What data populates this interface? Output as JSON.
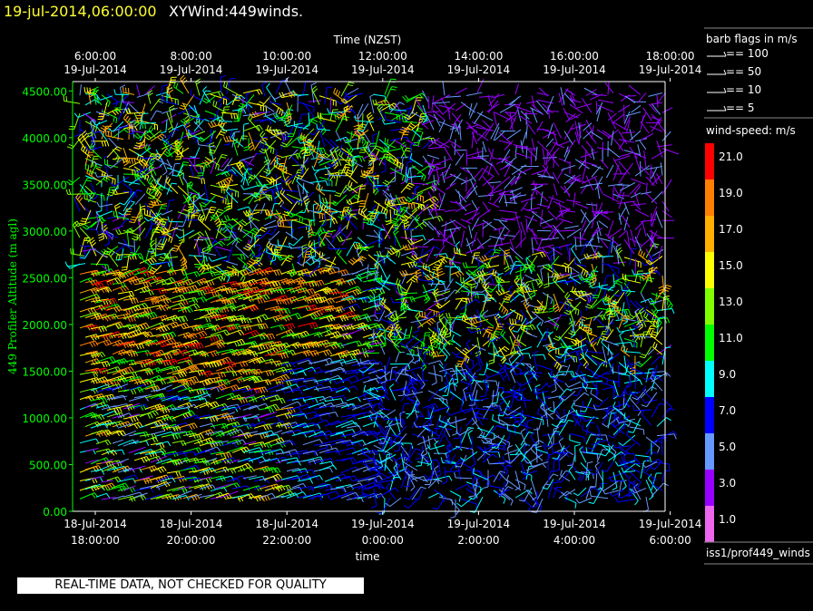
{
  "header": {
    "date_label": "19-jul-2014,06:00:00",
    "product_label": "XYWind:449winds."
  },
  "notice": "REAL-TIME DATA, NOT CHECKED FOR QUALITY",
  "source_label": "iss1/prof449_winds",
  "chart_data": {
    "type": "wind-barb",
    "top_axis": {
      "title": "Time (NZST)",
      "ticks": [
        {
          "time": "6:00:00",
          "date": "19-Jul-2014"
        },
        {
          "time": "8:00:00",
          "date": "19-Jul-2014"
        },
        {
          "time": "10:00:00",
          "date": "19-Jul-2014"
        },
        {
          "time": "12:00:00",
          "date": "19-Jul-2014"
        },
        {
          "time": "14:00:00",
          "date": "19-Jul-2014"
        },
        {
          "time": "16:00:00",
          "date": "19-Jul-2014"
        },
        {
          "time": "18:00:00",
          "date": "19-Jul-2014"
        }
      ]
    },
    "bottom_axis": {
      "title": "time",
      "ticks": [
        {
          "date": "18-Jul-2014",
          "time": "18:00:00"
        },
        {
          "date": "18-Jul-2014",
          "time": "20:00:00"
        },
        {
          "date": "18-Jul-2014",
          "time": "22:00:00"
        },
        {
          "date": "19-Jul-2014",
          "time": "0:00:00"
        },
        {
          "date": "19-Jul-2014",
          "time": "2:00:00"
        },
        {
          "date": "19-Jul-2014",
          "time": "4:00:00"
        },
        {
          "date": "19-Jul-2014",
          "time": "6:00:00"
        }
      ]
    },
    "y_axis": {
      "title": "449 Profiler Altitude (m agl)",
      "ticks": [
        "0.00",
        "500.00",
        "1000.00",
        "1500.00",
        "2000.00",
        "2500.00",
        "3000.00",
        "3500.00",
        "4000.00",
        "4500.00"
      ],
      "range": [
        0,
        4600
      ]
    },
    "x_range_hours": [
      0,
      12.3
    ],
    "barb_legend": {
      "title": "barb flags in m/s",
      "entries": [
        "== 100",
        "== 50",
        "== 10",
        "== 5"
      ]
    },
    "speed_legend": {
      "title": "wind-speed: m/s",
      "bins": [
        {
          "label": "21.0",
          "color": "#ff0000"
        },
        {
          "label": "19.0",
          "color": "#ff8000"
        },
        {
          "label": "17.0",
          "color": "#ffb000"
        },
        {
          "label": "15.0",
          "color": "#ffff00"
        },
        {
          "label": "13.0",
          "color": "#80ff00"
        },
        {
          "label": "11.0",
          "color": "#00ff00"
        },
        {
          "label": "9.0",
          "color": "#00ffff"
        },
        {
          "label": "7.0",
          "color": "#0000ff"
        },
        {
          "label": "5.0",
          "color": "#6699ff"
        },
        {
          "label": "3.0",
          "color": "#9900ff"
        },
        {
          "label": "1.0",
          "color": "#ee66ee"
        }
      ]
    },
    "colors": {
      "axis": "#00ff00",
      "text": "#ffffff",
      "background": "#000000"
    }
  }
}
